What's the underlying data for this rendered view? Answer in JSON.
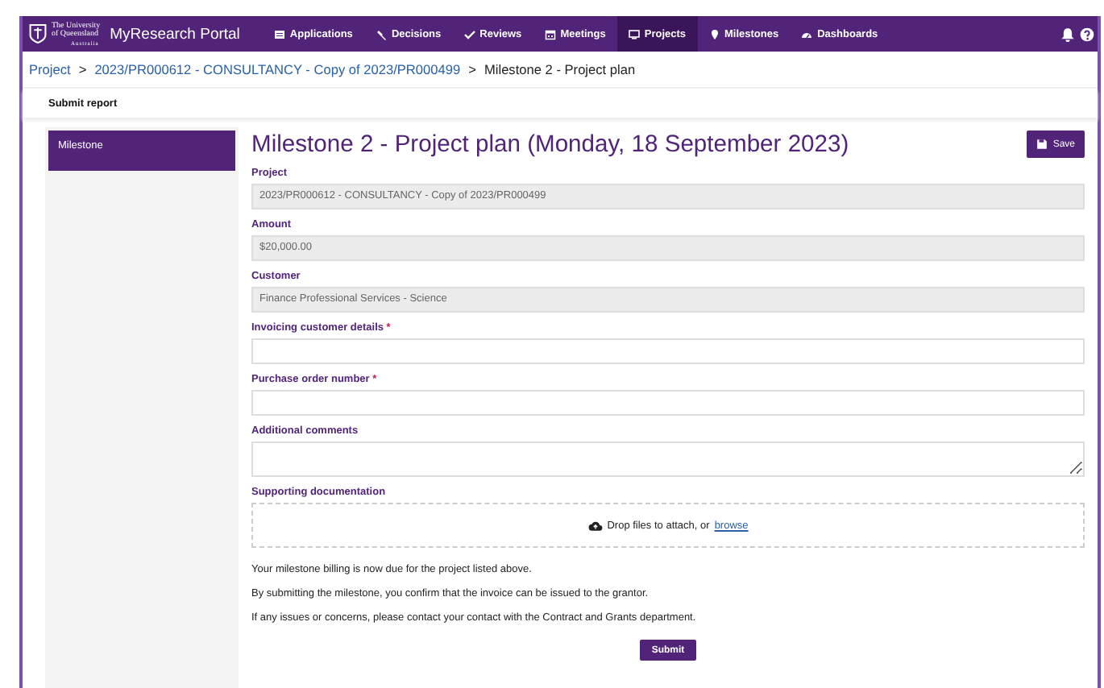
{
  "logo": {
    "lines": [
      "The University",
      "of Queensland",
      "Australia"
    ],
    "portal": "MyResearch Portal"
  },
  "nav": [
    {
      "label": "Applications",
      "selected": false
    },
    {
      "label": "Decisions",
      "selected": false
    },
    {
      "label": "Reviews",
      "selected": false
    },
    {
      "label": "Meetings",
      "selected": false
    },
    {
      "label": "Projects",
      "selected": true
    },
    {
      "label": "Milestones",
      "selected": false
    },
    {
      "label": "Dashboards",
      "selected": false
    }
  ],
  "breadcrumb": [
    {
      "label": "Project",
      "kind": "link"
    },
    {
      "label": ">",
      "kind": "text"
    },
    {
      "label": "2023/PR000612 - CONSULTANCY - Copy of 2023/PR000499",
      "kind": "link"
    },
    {
      "label": ">",
      "kind": "text"
    },
    {
      "label": "Milestone 2 - Project plan",
      "kind": "text"
    }
  ],
  "section_title": "Submit report",
  "sidebar": {
    "items": [
      {
        "label": "Milestone",
        "selected": true
      }
    ]
  },
  "heading": "Milestone 2 - Project plan (Monday, 18 September 2023)",
  "save_button": "Save",
  "fields": [
    {
      "kind": "readonly",
      "label": "Project",
      "value": "2023/PR000612 - CONSULTANCY - Copy of 2023/PR000499"
    },
    {
      "kind": "readonly",
      "label": "Amount",
      "value": "$20,000.00"
    },
    {
      "kind": "readonly",
      "label": "Customer",
      "value": "Finance Professional Services - Science"
    },
    {
      "kind": "input",
      "label": "Invoicing customer details",
      "required_mark": "*"
    },
    {
      "kind": "input",
      "label": "Purchase order number",
      "required_mark": "*"
    },
    {
      "kind": "textarea",
      "label": "Additional comments"
    },
    {
      "kind": "dropzone",
      "label": "Supporting documentation",
      "text": "Drop files to attach, or",
      "link": "browse"
    }
  ],
  "notes": [
    "Your milestone billing is now due for the project listed above.",
    "By submitting the milestone, you confirm that the invoice can be issued to the grantor.",
    "If any issues or concerns, please contact your contact with the Contract and Grants department."
  ],
  "submit_button": "Submit"
}
